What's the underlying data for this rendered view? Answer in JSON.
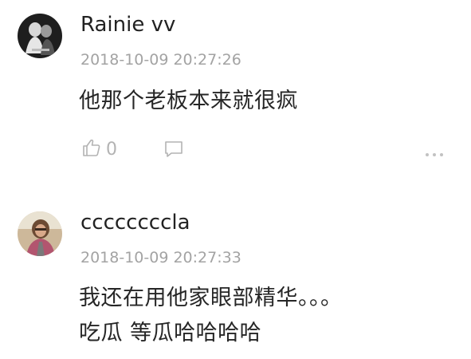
{
  "comments": [
    {
      "username": "Rainie vv",
      "timestamp": "2018-10-09 20:27:26",
      "lines": [
        "他那个老板本来就很疯"
      ],
      "like_count": "0",
      "avatar": "black-and-white-photo-avatar"
    },
    {
      "username": "ccccccccla",
      "timestamp": "2018-10-09 20:27:33",
      "lines": [
        "我还在用他家眼部精华。。。",
        "吃瓜 等瓜哈哈哈哈"
      ],
      "avatar": "color-photo-avatar"
    }
  ],
  "icons": {
    "like": "thumbs-up-icon",
    "reply": "speech-bubble-icon",
    "more": "ellipsis-icon"
  },
  "colors": {
    "username": "#222222",
    "timestamp": "#a3a3a3",
    "text": "#262626",
    "action_icon": "#b3b3b3"
  }
}
